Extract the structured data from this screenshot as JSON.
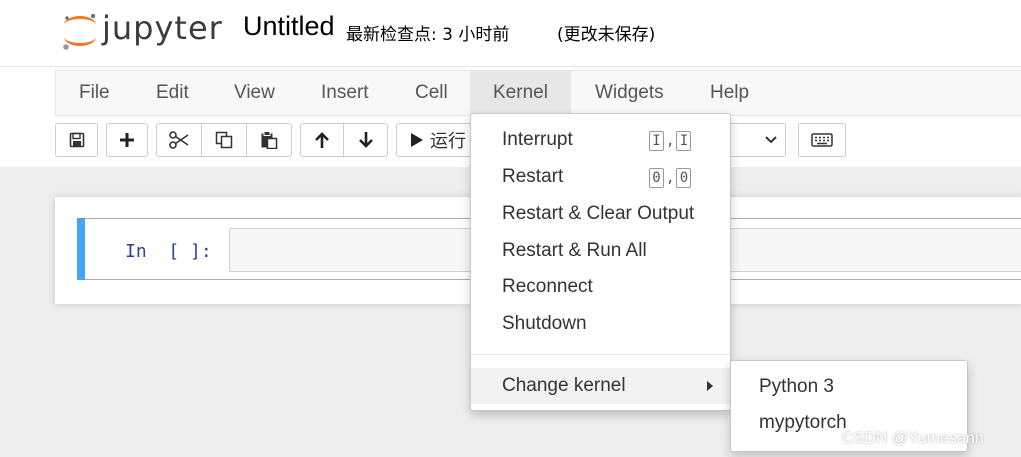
{
  "header": {
    "logo_text": "jupyter",
    "notebook_title": "Untitled",
    "checkpoint": "最新检查点: 3 小时前",
    "autosave_status": "(更改未保存)"
  },
  "menubar": {
    "items": [
      {
        "label": "File"
      },
      {
        "label": "Edit"
      },
      {
        "label": "View"
      },
      {
        "label": "Insert"
      },
      {
        "label": "Cell"
      },
      {
        "label": "Kernel"
      },
      {
        "label": "Widgets"
      },
      {
        "label": "Help"
      }
    ],
    "active": "Kernel"
  },
  "toolbar": {
    "run_label": "运行",
    "icons": [
      "save-icon",
      "plus-icon",
      "scissors-icon",
      "copy-icon",
      "paste-icon",
      "arrow-up-icon",
      "arrow-down-icon",
      "play-icon",
      "chevron-down-icon",
      "keyboard-icon"
    ]
  },
  "cell": {
    "prompt": "In  [ ]:"
  },
  "kernel_menu": {
    "items": [
      {
        "label": "Interrupt",
        "keys": [
          "I",
          "I"
        ]
      },
      {
        "label": "Restart",
        "keys": [
          "0",
          "0"
        ]
      },
      {
        "label": "Restart & Clear Output"
      },
      {
        "label": "Restart & Run All"
      },
      {
        "label": "Reconnect"
      },
      {
        "label": "Shutdown"
      }
    ],
    "change_kernel": "Change kernel",
    "kernels": [
      "Python 3",
      "mypytorch"
    ]
  },
  "watermark": "CSDN @Yumesann",
  "colors": {
    "cell_selected_bar": "#42a5f5",
    "prompt": "#303f9f",
    "logo_orange": "#f37726"
  }
}
